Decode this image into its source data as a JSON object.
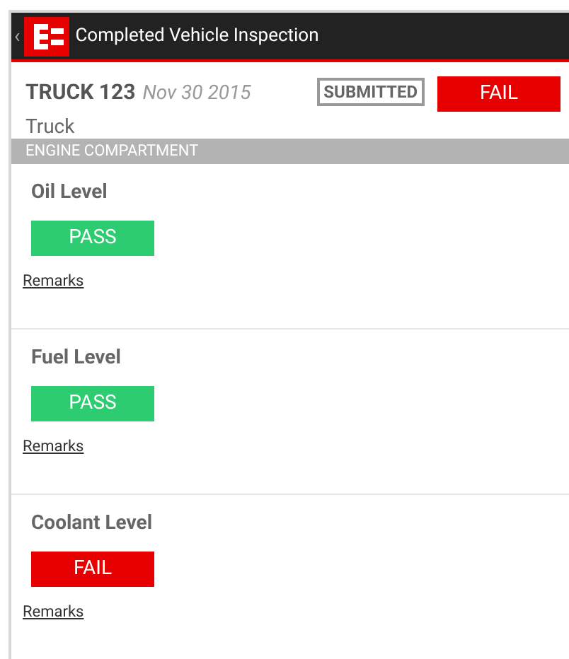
{
  "app_bar": {
    "back": "‹",
    "title": "Completed Vehicle Inspection"
  },
  "vehicle": {
    "name": "TRUCK 123",
    "date": "Nov 30 2015",
    "type": "Truck",
    "status": "SUBMITTED",
    "result": {
      "text": "FAIL",
      "kind": "fail"
    }
  },
  "section": {
    "title": "ENGINE COMPARTMENT"
  },
  "items": [
    {
      "name": "Oil Level",
      "result": {
        "text": "PASS",
        "kind": "pass"
      },
      "link": "Remarks"
    },
    {
      "name": "Fuel Level",
      "result": {
        "text": "PASS",
        "kind": "pass"
      },
      "link": "Remarks"
    },
    {
      "name": "Coolant Level",
      "result": {
        "text": "FAIL",
        "kind": "fail"
      },
      "link": "Remarks"
    }
  ]
}
